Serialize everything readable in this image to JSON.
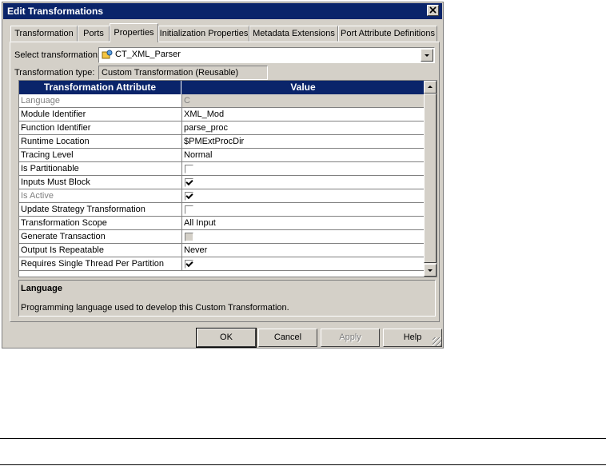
{
  "window": {
    "title": "Edit Transformations"
  },
  "tabs": [
    {
      "label": "Transformation"
    },
    {
      "label": "Ports"
    },
    {
      "label": "Properties",
      "active": true
    },
    {
      "label": "Initialization Properties"
    },
    {
      "label": "Metadata Extensions"
    },
    {
      "label": "Port Attribute Definitions"
    }
  ],
  "select_transformation": {
    "label": "Select transformation:",
    "value": "CT_XML_Parser",
    "icon": "transformation-icon"
  },
  "transformation_type": {
    "label": "Transformation type:",
    "value": "Custom Transformation (Reusable)"
  },
  "grid": {
    "headers": [
      "Transformation Attribute",
      "Value"
    ],
    "rows": [
      {
        "attribute": "Language",
        "value": "C",
        "type": "text",
        "disabled": true
      },
      {
        "attribute": "Module Identifier",
        "value": "XML_Mod",
        "type": "text"
      },
      {
        "attribute": "Function Identifier",
        "value": "parse_proc",
        "type": "text"
      },
      {
        "attribute": "Runtime Location",
        "value": "$PMExtProcDir",
        "type": "text"
      },
      {
        "attribute": "Tracing Level",
        "value": "Normal",
        "type": "text"
      },
      {
        "attribute": "Is Partitionable",
        "checked": false,
        "type": "checkbox"
      },
      {
        "attribute": "Inputs Must Block",
        "checked": true,
        "type": "checkbox"
      },
      {
        "attribute": "Is Active",
        "checked": true,
        "type": "checkbox",
        "disabled": true
      },
      {
        "attribute": "Update Strategy Transformation",
        "checked": false,
        "type": "checkbox"
      },
      {
        "attribute": "Transformation Scope",
        "value": "All Input",
        "type": "text"
      },
      {
        "attribute": "Generate Transaction",
        "checked": false,
        "type": "checkbox",
        "greyed": true
      },
      {
        "attribute": "Output Is Repeatable",
        "value": "Never",
        "type": "text"
      },
      {
        "attribute": "Requires Single Thread Per Partition",
        "checked": true,
        "type": "checkbox"
      }
    ]
  },
  "description": {
    "title": "Language",
    "text": "Programming language used to develop this Custom Transformation."
  },
  "buttons": {
    "ok": "OK",
    "cancel": "Cancel",
    "apply": "Apply",
    "help": "Help"
  }
}
